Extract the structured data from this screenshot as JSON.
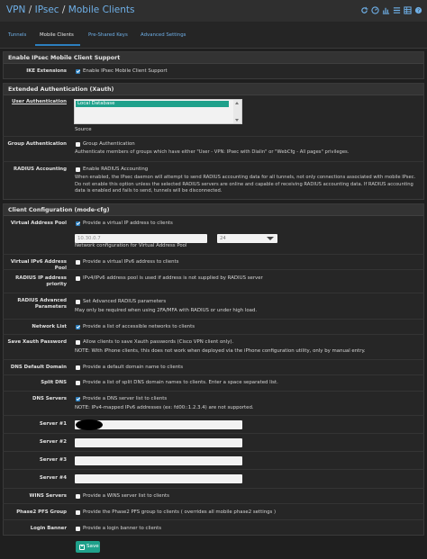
{
  "breadcrumb": {
    "part1": "VPN",
    "sep": "/",
    "part2": "IPsec",
    "part3": "Mobile Clients"
  },
  "tabs": [
    {
      "label": "Tunnels"
    },
    {
      "label": "Mobile Clients"
    },
    {
      "label": "Pre-Shared Keys"
    },
    {
      "label": "Advanced Settings"
    }
  ],
  "sections": {
    "mobile": "Enable IPsec Mobile Client Support",
    "xauth": "Extended Authentication (Xauth)",
    "modecfg": "Client Configuration (mode-cfg)"
  },
  "ike": {
    "label": "IKE Extensions",
    "text": "Enable IPsec Mobile Client Support"
  },
  "user_auth": {
    "label": "User Authentication",
    "option": "Local Database",
    "hint": "Source"
  },
  "group_auth": {
    "label": "Group Authentication",
    "text": "Group Authentication",
    "help": "Authenticate members of groups which have either \"User - VPN: IPsec with Dialin\" or \"WebCfg - All pages\" privileges."
  },
  "radius_acct": {
    "label": "RADIUS Accounting",
    "text": "Enable RADIUS Accounting",
    "help": "When enabled, the IPsec daemon will attempt to send RADIUS accounting data for all tunnels, not only connections associated with mobile IPsec. Do not enable this option unless the selected RADIUS servers are online and capable of receiving RADIUS accounting data. If RADIUS accounting data is enabled and fails to send, tunnels will be disconnected."
  },
  "vap": {
    "label": "Virtual Address Pool",
    "text": "Provide a virtual IP address to clients",
    "address": "10.30.0.7",
    "mask": "24",
    "hint": "Network configuration for Virtual Address Pool"
  },
  "vap6": {
    "label": "Virtual IPv6 Address Pool",
    "text": "Provide a virtual IPv6 address to clients"
  },
  "radius_ip": {
    "label1": "RADIUS IP address",
    "label2": "priority",
    "text": "IPv4/IPv6 address pool is used if address is not supplied by RADIUS server"
  },
  "radius_adv": {
    "label1": "RADIUS Advanced",
    "label2": "Parameters",
    "text": "Set Advanced RADIUS parameters",
    "help": "May only be required when using 2FA/MFA with RADIUS or under high load."
  },
  "netlist": {
    "label": "Network List",
    "text": "Provide a list of accessible networks to clients"
  },
  "savepw": {
    "label": "Save Xauth Password",
    "text": "Allow clients to save Xauth passwords (Cisco VPN client only).",
    "help": "NOTE: With iPhone clients, this does not work when deployed via the iPhone configuration utility, only by manual entry."
  },
  "dnsdomain": {
    "label": "DNS Default Domain",
    "text": "Provide a default domain name to clients"
  },
  "splitdns": {
    "label": "Split DNS",
    "text": "Provide a list of split DNS domain names to clients. Enter a space separated list."
  },
  "dnsservers": {
    "label": "DNS Servers",
    "text": "Provide a DNS server list to clients",
    "help": "NOTE: IPv4-mapped IPv6 addresses (ex: fd00::1.2.3.4) are not supported."
  },
  "servers": [
    {
      "label": "Server #1"
    },
    {
      "label": "Server #2"
    },
    {
      "label": "Server #3"
    },
    {
      "label": "Server #4"
    }
  ],
  "wins": {
    "label": "WINS Servers",
    "text": "Provide a WINS server list to clients"
  },
  "pfs": {
    "label": "Phase2 PFS Group",
    "text": "Provide the Phase2 PFS group to clients ( overrides all mobile phase2 settings )"
  },
  "banner": {
    "label": "Login Banner",
    "text": "Provide a login banner to clients"
  },
  "save_label": "Save",
  "colors": {
    "accent": "#2c7fbf",
    "save": "#1fa18b",
    "link": "#6fb0e8"
  }
}
